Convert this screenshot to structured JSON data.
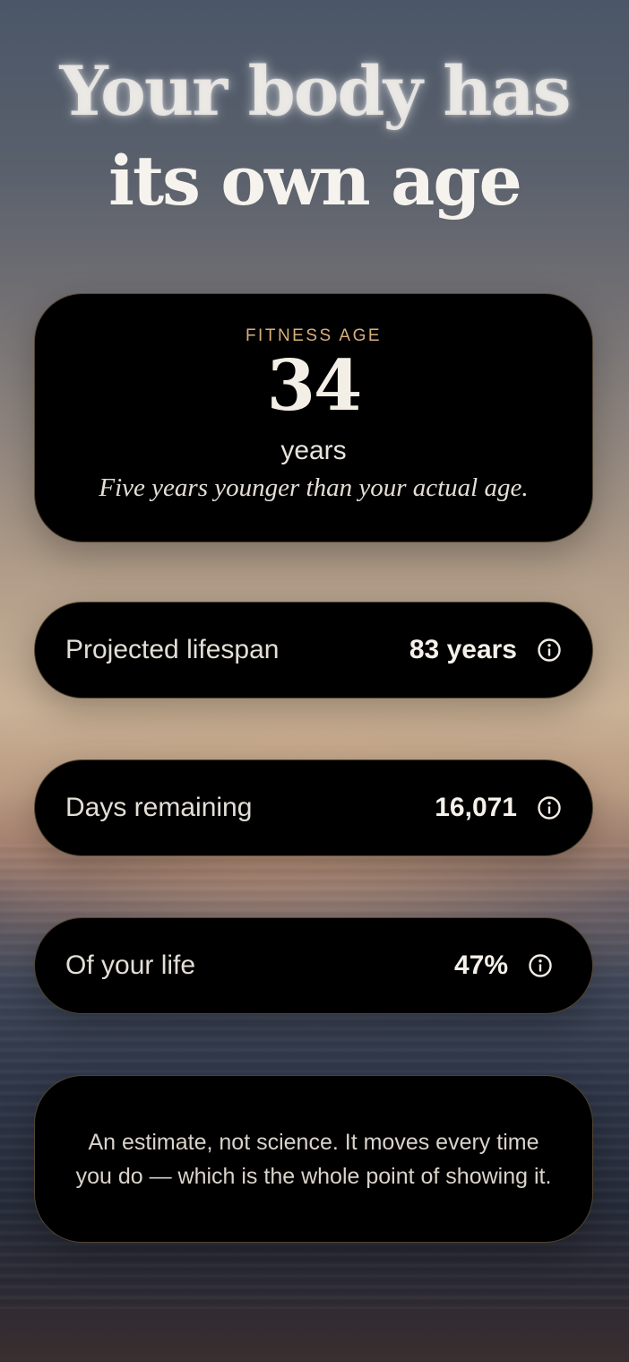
{
  "header": {
    "title_line1": "Your body has",
    "title_line2": "its own age"
  },
  "fitness_card": {
    "label": "FITNESS AGE",
    "value": "34",
    "unit": "years",
    "note": "Five years younger than your actual age."
  },
  "stats": [
    {
      "label": "Projected lifespan",
      "value": "83 years",
      "icon": "info-icon"
    },
    {
      "label": "Days remaining",
      "value": "16,071",
      "icon": "info-icon"
    },
    {
      "label": "Of your life",
      "value": "47%",
      "icon": "info-icon"
    }
  ],
  "disclaimer": {
    "text": "An estimate, not science. It moves every time you do — which is the whole point of showing it."
  },
  "colors": {
    "accent_gold": "#d9b07a",
    "card_background": "#000000",
    "card_border": "#967d5a"
  }
}
